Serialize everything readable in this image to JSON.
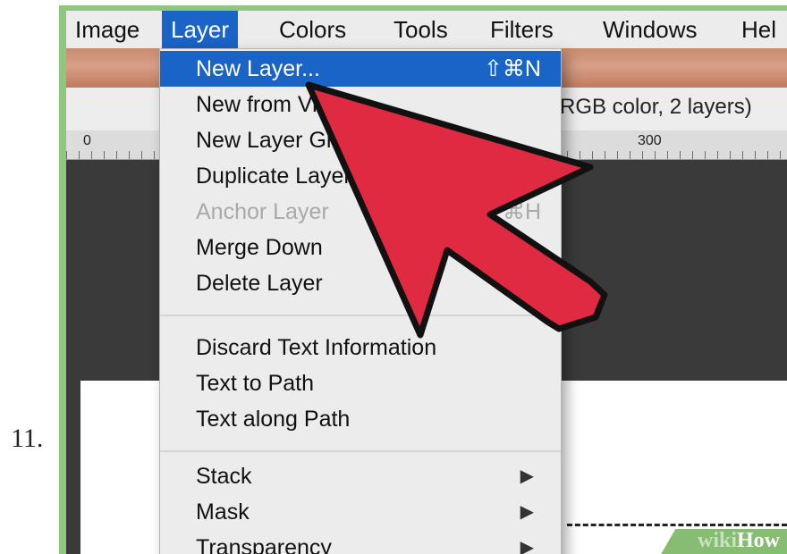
{
  "step": {
    "number": "11."
  },
  "menubar": {
    "items": [
      {
        "label": "Image"
      },
      {
        "label": "Layer",
        "active": true
      },
      {
        "label": "Colors"
      },
      {
        "label": "Tools"
      },
      {
        "label": "Filters"
      },
      {
        "label": "Windows"
      },
      {
        "label": "Hel"
      }
    ]
  },
  "window": {
    "title_fragment": "RGB color, 2 layers)",
    "ruler_ticks": [
      "0",
      "300"
    ]
  },
  "layer_menu": {
    "items": [
      {
        "label": "New Layer...",
        "shortcut": "⇧⌘N",
        "state": "highlighted"
      },
      {
        "label": "New from Visible",
        "state": "normal"
      },
      {
        "label": "New Layer Group",
        "state": "normal"
      },
      {
        "label": "Duplicate Layer",
        "state": "normal"
      },
      {
        "label": "Anchor Layer",
        "shortcut": "⌘H",
        "state": "disabled"
      },
      {
        "label": "Merge Down",
        "state": "normal"
      },
      {
        "label": "Delete Layer",
        "state": "normal"
      },
      {
        "label": "Discard Text Information",
        "state": "normal"
      },
      {
        "label": "Text to Path",
        "state": "normal"
      },
      {
        "label": "Text along Path",
        "state": "normal"
      },
      {
        "label": "Stack",
        "submenu": "▶",
        "state": "normal"
      },
      {
        "label": "Mask",
        "submenu": "▶",
        "state": "normal"
      },
      {
        "label": "Transparency",
        "submenu": "▶",
        "state": "normal"
      }
    ]
  },
  "watermark": {
    "wiki": "wiki",
    "how": "How"
  },
  "colors": {
    "menu_highlight": "#1a63c7",
    "pointer_arrow": "#e02a42",
    "frame_green": "#8fc77e"
  },
  "icons": {
    "pointer": "red-arrow-pointer-icon",
    "submenu": "triangle-right-icon"
  }
}
